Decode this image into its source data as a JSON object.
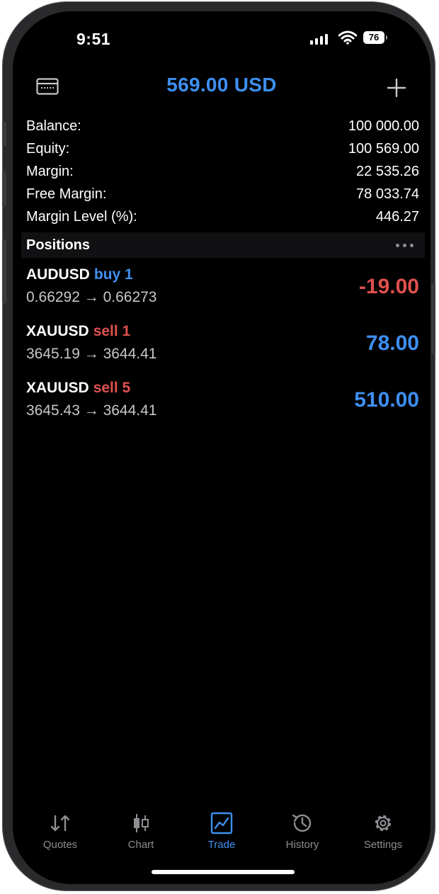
{
  "status_bar": {
    "time": "9:51",
    "battery": "76"
  },
  "header": {
    "title": "569.00 USD"
  },
  "account": [
    {
      "label": "Balance:",
      "value": "100 000.00"
    },
    {
      "label": "Equity:",
      "value": "100 569.00"
    },
    {
      "label": "Margin:",
      "value": "22 535.26"
    },
    {
      "label": "Free Margin:",
      "value": "78 033.74"
    },
    {
      "label": "Margin Level (%):",
      "value": "446.27"
    }
  ],
  "positions": {
    "title": "Positions",
    "items": [
      {
        "symbol": "AUDUSD",
        "side": "buy 1",
        "side_color": "#3e8ff0",
        "prices": "0.66292 → 0.66273",
        "profit": "-19.00",
        "profit_color": "#e0514e"
      },
      {
        "symbol": "XAUUSD",
        "side": "sell 1",
        "side_color": "#e0514e",
        "prices": "3645.19 → 3644.41",
        "profit": "78.00",
        "profit_color": "#3e8ff0"
      },
      {
        "symbol": "XAUUSD",
        "side": "sell 5",
        "side_color": "#e0514e",
        "prices": "3645.43 → 3644.41",
        "profit": "510.00",
        "profit_color": "#3e8ff0"
      }
    ]
  },
  "tabbar": {
    "tabs": [
      {
        "label": "Quotes",
        "icon": "quotes-icon"
      },
      {
        "label": "Chart",
        "icon": "candlestick-icon"
      },
      {
        "label": "Trade",
        "icon": "trade-chart-icon",
        "active": true
      },
      {
        "label": "History",
        "icon": "history-icon"
      },
      {
        "label": "Settings",
        "icon": "gear-icon"
      }
    ]
  },
  "colors": {
    "accent": "#3e8ff0",
    "negative": "#e0514e",
    "background": "#000000"
  }
}
